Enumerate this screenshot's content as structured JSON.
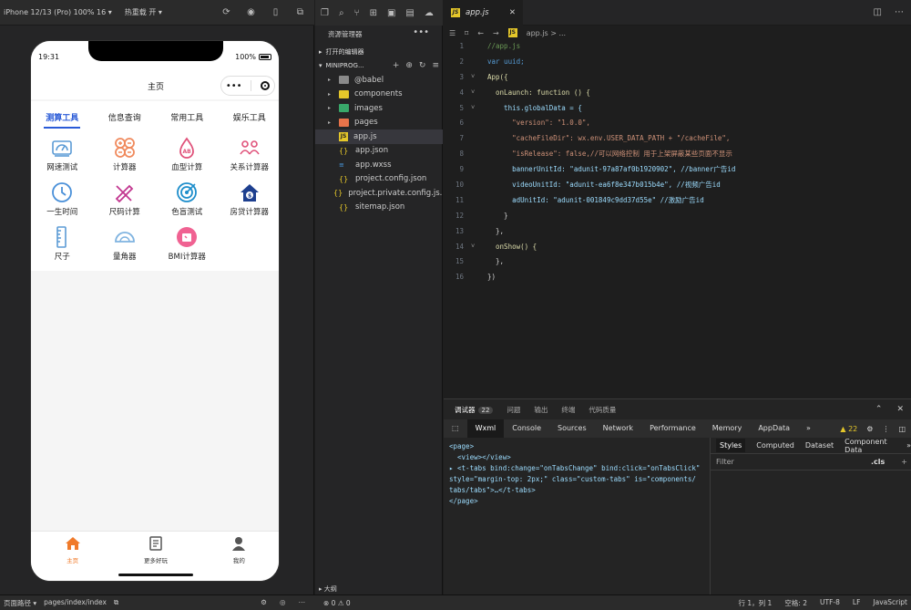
{
  "simulator": {
    "device_label": "iPhone 12/13 (Pro) 100% 16 ▾",
    "hot_reload": "热重载 开 ▾",
    "status_time": "19:31",
    "battery": "100%",
    "nav_title": "主页",
    "capsule_dots": "•••",
    "tabs": [
      {
        "label": "测算工具",
        "active": true
      },
      {
        "label": "信息查询",
        "active": false
      },
      {
        "label": "常用工具",
        "active": false
      },
      {
        "label": "娱乐工具",
        "active": false
      }
    ],
    "tools": [
      {
        "label": "网速测试",
        "icon": "speedometer-icon",
        "color": "#5b9bd5"
      },
      {
        "label": "计算器",
        "icon": "calculator-icon",
        "color": "#f08a5d"
      },
      {
        "label": "血型计算",
        "icon": "blood-drop-icon",
        "color": "#e0527a"
      },
      {
        "label": "关系计算器",
        "icon": "people-icon",
        "color": "#e0527a"
      },
      {
        "label": "一生时间",
        "icon": "clock-icon",
        "color": "#4a90d9"
      },
      {
        "label": "尺码计算",
        "icon": "ruler-pencil-icon",
        "color": "#c2368f"
      },
      {
        "label": "色盲测试",
        "icon": "target-icon",
        "color": "#1e8ecb"
      },
      {
        "label": "房贷计算器",
        "icon": "house-dollar-icon",
        "color": "#1d3f8f"
      },
      {
        "label": "尺子",
        "icon": "ruler-icon",
        "color": "#5b9bd5"
      },
      {
        "label": "量角器",
        "icon": "protractor-icon",
        "color": "#7fb3e0"
      },
      {
        "label": "BMI计算器",
        "icon": "scale-icon",
        "color": "#f06292"
      }
    ],
    "tabbar": [
      {
        "label": "主页",
        "icon": "home-icon",
        "active": true
      },
      {
        "label": "更多好玩",
        "icon": "book-icon",
        "active": false
      },
      {
        "label": "我的",
        "icon": "user-icon",
        "active": false
      }
    ],
    "accent": "#2a5bd7"
  },
  "explorer": {
    "title": "资源管理器",
    "more": "•••",
    "open_editors": "打开的编辑器",
    "project": "MINIPROG...",
    "files": [
      {
        "name": "@babel",
        "type": "folder",
        "color": "#8a8a8a",
        "caret": "▸"
      },
      {
        "name": "components",
        "type": "folder",
        "color": "#e5c72a",
        "caret": "▸"
      },
      {
        "name": "images",
        "type": "folder",
        "color": "#39a86a",
        "caret": "▸"
      },
      {
        "name": "pages",
        "type": "folder",
        "color": "#e8734a",
        "caret": "▸"
      },
      {
        "name": "app.js",
        "type": "js",
        "selected": true
      },
      {
        "name": "app.json",
        "type": "json"
      },
      {
        "name": "app.wxss",
        "type": "wxss"
      },
      {
        "name": "project.config.json",
        "type": "json"
      },
      {
        "name": "project.private.config.js...",
        "type": "json"
      },
      {
        "name": "sitemap.json",
        "type": "json"
      }
    ],
    "outline": "大纲"
  },
  "editor": {
    "tab": "app.js",
    "breadcrumb": "app.js > ...",
    "lines": [
      {
        "n": "1",
        "fold": "",
        "text": "//app.js",
        "color": "#6a9955"
      },
      {
        "n": "2",
        "fold": "",
        "text": "var uuid;",
        "color": "#569cd6"
      },
      {
        "n": "3",
        "fold": "˅",
        "text": "App({",
        "color": "#dcdcaa"
      },
      {
        "n": "4",
        "fold": "˅",
        "text": "  onLaunch: function () {",
        "color": "#dcdcaa"
      },
      {
        "n": "5",
        "fold": "˅",
        "text": "    this.globalData = {",
        "color": "#9cdcfe"
      },
      {
        "n": "6",
        "fold": "",
        "text": "      \"version\": \"1.0.0\",",
        "color": "#ce9178"
      },
      {
        "n": "7",
        "fold": "",
        "text": "      \"cacheFileDir\": wx.env.USER_DATA_PATH + \"/cacheFile\",",
        "color": "#ce9178"
      },
      {
        "n": "8",
        "fold": "",
        "text": "      \"isRelease\": false,//可以网络控制 用于上架屏蔽某些页面不显示",
        "color": "#ce9178"
      },
      {
        "n": "9",
        "fold": "",
        "text": "      bannerUnitId: \"adunit-97a87af0b1920902\", //banner广告id",
        "color": "#9cdcfe"
      },
      {
        "n": "10",
        "fold": "",
        "text": "      videoUnitId: \"adunit-ea6f8e347b015b4e\", //视频广告id",
        "color": "#9cdcfe"
      },
      {
        "n": "11",
        "fold": "",
        "text": "      adUnitId: \"adunit-001849c9dd37d55e\" //激励广告id",
        "color": "#9cdcfe"
      },
      {
        "n": "12",
        "fold": "",
        "text": "    }",
        "color": "#d4d4d4"
      },
      {
        "n": "13",
        "fold": "",
        "text": "  },",
        "color": "#d4d4d4"
      },
      {
        "n": "14",
        "fold": "˅",
        "text": "  onShow() {",
        "color": "#dcdcaa"
      },
      {
        "n": "15",
        "fold": "",
        "text": "  },",
        "color": "#d4d4d4"
      },
      {
        "n": "16",
        "fold": "",
        "text": "})",
        "color": "#d4d4d4"
      }
    ]
  },
  "devtools": {
    "top_tabs": [
      "调试器",
      "问题",
      "输出",
      "终端",
      "代码质量"
    ],
    "debugger_count": "22",
    "panel_tabs": [
      "Wxml",
      "Console",
      "Sources",
      "Network",
      "Performance",
      "Memory",
      "AppData",
      "»"
    ],
    "warnings": "▲ 22",
    "wxml_lines": [
      "<page>",
      "  <view></view>",
      "▸ <t-tabs bind:change=\"onTabsChange\" bind:click=\"onTabsClick\"",
      "style=\"margin-top: 2px;\" class=\"custom-tabs\" is=\"components/",
      "tabs/tabs\">…</t-tabs>",
      "</page>"
    ],
    "styles_tabs": [
      "Styles",
      "Computed",
      "Dataset",
      "Component Data",
      "»"
    ],
    "filter_placeholder": "Filter",
    "cls": ".cls",
    "plus": "+"
  },
  "statusbar": {
    "path_label": "页面路径 ▾",
    "path": "pages/index/index",
    "errors": "⊗ 0 ⚠ 0",
    "position": "行 1，列 1",
    "spaces": "空格: 2",
    "encoding": "UTF-8",
    "eol": "LF",
    "lang": "JavaScript"
  }
}
